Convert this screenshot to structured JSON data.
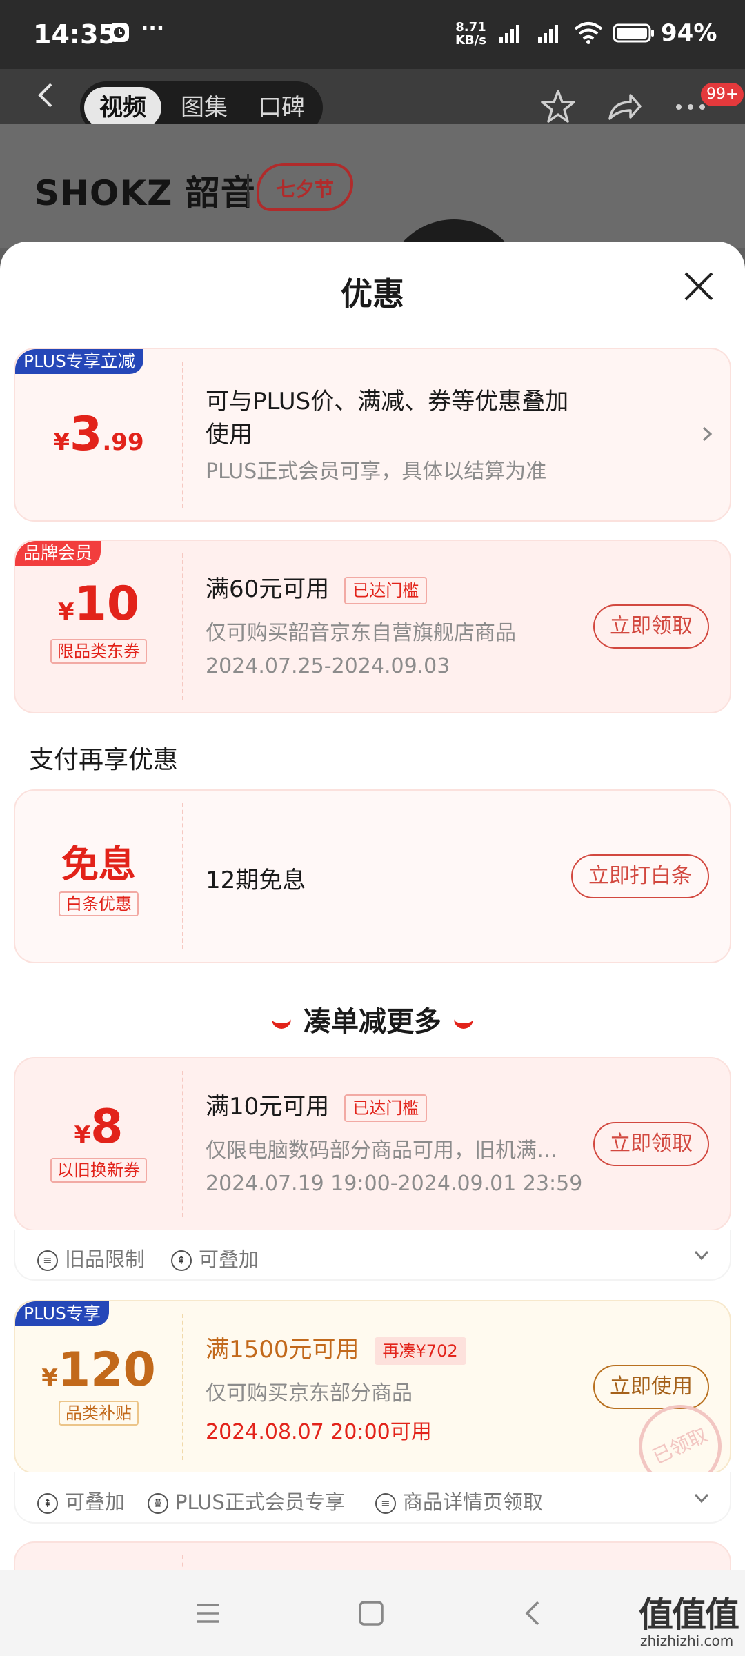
{
  "status_bar": {
    "time": "14:35",
    "more": "···",
    "net_speed_value": "8.71",
    "net_speed_unit": "KB/s",
    "battery": "94%"
  },
  "top_nav": {
    "tabs": [
      "视频",
      "图集",
      "口碑"
    ],
    "active_tab": 0,
    "badge": "99+",
    "icons": [
      "back-icon",
      "star-icon",
      "share-icon",
      "more-icon"
    ]
  },
  "hero": {
    "brand": "SHOKZ 韶音",
    "festival": "七夕节"
  },
  "sheet": {
    "title": "优惠",
    "coupons": [
      {
        "tag": "PLUS专享立减",
        "currency": "¥",
        "amount": "3",
        "decimal": ".99",
        "title_line1": "可与PLUS价、满减、券等优惠叠加",
        "title_line2": "使用",
        "desc": "PLUS正式会员可享，具体以结算为准"
      },
      {
        "tag": "品牌会员",
        "currency": "¥",
        "amount": "10",
        "subtag": "限品类东券",
        "title": "满60元可用",
        "chip": "已达门槛",
        "desc": "仅可购买韶音京东自营旗舰店商品",
        "date": "2024.07.25-2024.09.03",
        "button": "立即领取"
      }
    ],
    "pay_section": {
      "heading": "支付再享优惠",
      "amount": "免息",
      "subtag": "白条优惠",
      "title": "12期免息",
      "button": "立即打白条"
    },
    "more_section": {
      "heading": "凑单减更多",
      "coupons": [
        {
          "currency": "¥",
          "amount": "8",
          "subtag": "以旧换新券",
          "title": "满10元可用",
          "chip": "已达门槛",
          "desc": "仅限电脑数码部分商品可用，旧机满…",
          "date": "2024.07.19 19:00-2024.09.01 23:59",
          "button": "立即领取",
          "features": [
            "旧品限制",
            "可叠加"
          ]
        },
        {
          "tag": "PLUS专享",
          "currency": "¥",
          "amount": "120",
          "subtag": "品类补贴",
          "title": "满1500元可用",
          "chip": "再凑¥702",
          "desc": "仅可购买京东部分商品",
          "date": "2024.08.07 20:00可用",
          "button": "立即使用",
          "stamp": "已领取",
          "features": [
            "可叠加",
            "PLUS正式会员专享",
            "商品详情页领取"
          ]
        }
      ]
    }
  },
  "watermark": {
    "text": "值值值",
    "url": "zhizhizhi.com"
  },
  "colors": {
    "accent_red": "#e2231a",
    "gold": "#c2691b",
    "plus_blue": "#2547b8"
  }
}
